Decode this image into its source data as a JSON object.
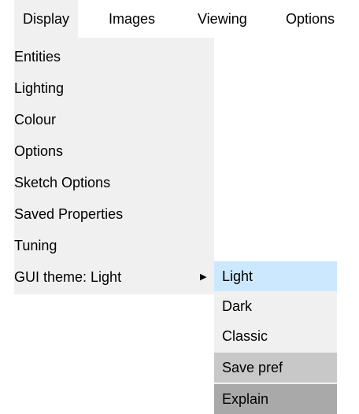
{
  "menubar": {
    "items": [
      "Display",
      "Images",
      "Viewing",
      "Options"
    ]
  },
  "display_menu": {
    "items": [
      {
        "label": "Entities"
      },
      {
        "label": "Lighting"
      },
      {
        "label": "Colour"
      },
      {
        "label": "Options"
      },
      {
        "label": "Sketch Options"
      },
      {
        "label": "Saved Properties"
      },
      {
        "label": "Tuning"
      },
      {
        "label": "GUI theme: Light",
        "arrow": "▶"
      }
    ]
  },
  "theme_submenu": {
    "items": [
      {
        "label": "Light"
      },
      {
        "label": "Dark"
      },
      {
        "label": "Classic"
      },
      {
        "label": "Save pref"
      },
      {
        "label": "Explain"
      }
    ]
  },
  "colors": {
    "menu_background": "#f0f0f0",
    "hover_highlight": "#cce8ff",
    "save_pref_background": "#c8c8c8",
    "explain_background": "#a9a9a9"
  }
}
